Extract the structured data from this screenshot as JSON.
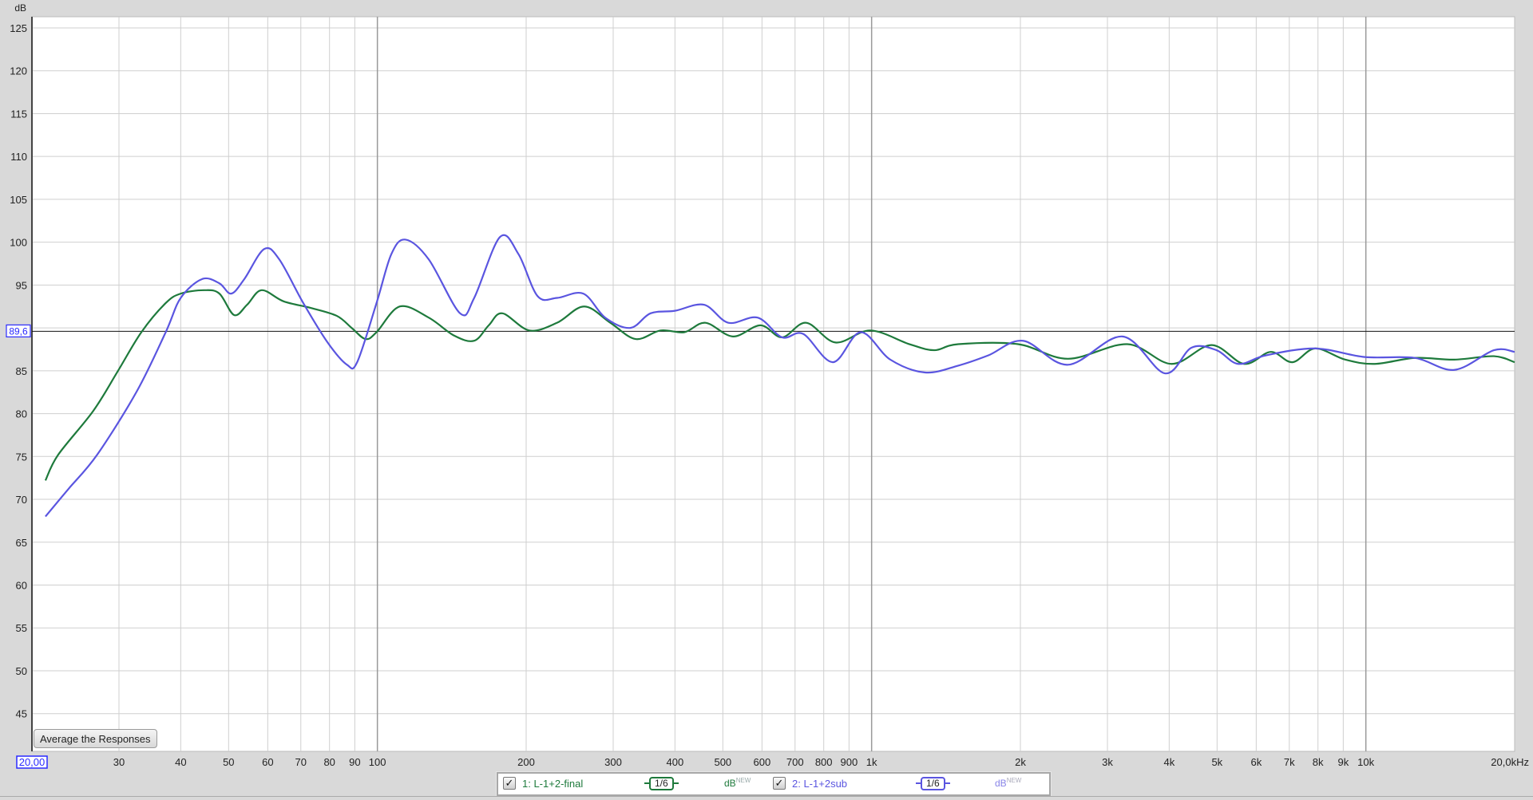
{
  "chart_data": {
    "type": "line",
    "ylabel": "dB",
    "xlabel": "Hz",
    "xscale": "log",
    "xlim": [
      20,
      20000
    ],
    "ylim": [
      40.6,
      126.3
    ],
    "grid": true,
    "y_ticks": [
      "125",
      "120",
      "115",
      "110",
      "105",
      "100",
      "95",
      "90",
      "85",
      "80",
      "75",
      "70",
      "65",
      "60",
      "55",
      "50",
      "45"
    ],
    "x_ticks": [
      {
        "f": 20,
        "label": "20,00"
      },
      {
        "f": 30,
        "label": "30"
      },
      {
        "f": 40,
        "label": "40"
      },
      {
        "f": 50,
        "label": "50"
      },
      {
        "f": 60,
        "label": "60"
      },
      {
        "f": 70,
        "label": "70"
      },
      {
        "f": 80,
        "label": "80"
      },
      {
        "f": 90,
        "label": "90"
      },
      {
        "f": 100,
        "label": "100"
      },
      {
        "f": 200,
        "label": "200"
      },
      {
        "f": 300,
        "label": "300"
      },
      {
        "f": 400,
        "label": "400"
      },
      {
        "f": 500,
        "label": "500"
      },
      {
        "f": 600,
        "label": "600"
      },
      {
        "f": 700,
        "label": "700"
      },
      {
        "f": 800,
        "label": "800"
      },
      {
        "f": 900,
        "label": "900"
      },
      {
        "f": 1000,
        "label": "1k"
      },
      {
        "f": 2000,
        "label": "2k"
      },
      {
        "f": 3000,
        "label": "3k"
      },
      {
        "f": 4000,
        "label": "4k"
      },
      {
        "f": 5000,
        "label": "5k"
      },
      {
        "f": 6000,
        "label": "6k"
      },
      {
        "f": 7000,
        "label": "7k"
      },
      {
        "f": 8000,
        "label": "8k"
      },
      {
        "f": 9000,
        "label": "9k"
      },
      {
        "f": 10000,
        "label": "10k"
      },
      {
        "f": 20000,
        "label": "20,0kHz"
      }
    ],
    "reference_line": {
      "value": 89.6,
      "label": "89,6"
    },
    "series": [
      {
        "name": "1: L-1+2-final",
        "color": "#1e7a3c",
        "smoothing": "1/6",
        "unit": "dB",
        "unit_sup": "NEW",
        "points": [
          [
            21.3,
            72.2
          ],
          [
            22.6,
            75.2
          ],
          [
            26.6,
            80.3
          ],
          [
            29.8,
            84.9
          ],
          [
            33.3,
            89.5
          ],
          [
            37.3,
            92.9
          ],
          [
            40,
            94
          ],
          [
            44.6,
            94.4
          ],
          [
            47.9,
            94
          ],
          [
            51.3,
            91.5
          ],
          [
            54.5,
            92.7
          ],
          [
            58.3,
            94.4
          ],
          [
            64.6,
            93.1
          ],
          [
            73.7,
            92.3
          ],
          [
            82.8,
            91.4
          ],
          [
            88.7,
            90
          ],
          [
            94.6,
            88.7
          ],
          [
            99.6,
            89.5
          ],
          [
            111,
            92.5
          ],
          [
            127,
            91.2
          ],
          [
            143,
            89.1
          ],
          [
            157,
            88.5
          ],
          [
            168,
            90.3
          ],
          [
            179,
            91.7
          ],
          [
            203,
            89.7
          ],
          [
            231,
            90.6
          ],
          [
            262,
            92.5
          ],
          [
            296,
            90.6
          ],
          [
            333,
            88.7
          ],
          [
            374,
            89.7
          ],
          [
            418,
            89.5
          ],
          [
            461,
            90.6
          ],
          [
            524,
            89
          ],
          [
            596,
            90.3
          ],
          [
            659,
            88.9
          ],
          [
            737,
            90.6
          ],
          [
            845,
            88.3
          ],
          [
            994,
            89.7
          ],
          [
            1193,
            88.1
          ],
          [
            1339,
            87.4
          ],
          [
            1497,
            88.1
          ],
          [
            1979,
            88.1
          ],
          [
            2495,
            86.4
          ],
          [
            3292,
            88.1
          ],
          [
            4045,
            85.8
          ],
          [
            4870,
            88
          ],
          [
            5672,
            85.8
          ],
          [
            6420,
            87.2
          ],
          [
            7103,
            86
          ],
          [
            7900,
            87.6
          ],
          [
            9080,
            86.3
          ],
          [
            10430,
            85.8
          ],
          [
            12550,
            86.5
          ],
          [
            15100,
            86.3
          ],
          [
            18160,
            86.7
          ],
          [
            20000,
            86
          ]
        ]
      },
      {
        "name": "2: L-1+2sub",
        "color": "#5a55e0",
        "smoothing": "1/6",
        "unit": "dB",
        "unit_sup": "NEW",
        "points": [
          [
            21.3,
            68
          ],
          [
            23.7,
            71.2
          ],
          [
            27.1,
            75.2
          ],
          [
            32.6,
            82.6
          ],
          [
            37.3,
            89.5
          ],
          [
            40,
            93.5
          ],
          [
            44.2,
            95.7
          ],
          [
            47.9,
            95.2
          ],
          [
            50.6,
            94
          ],
          [
            53.8,
            95.7
          ],
          [
            59,
            99.2
          ],
          [
            63.3,
            98
          ],
          [
            70.8,
            92.9
          ],
          [
            79.3,
            88.3
          ],
          [
            86.8,
            85.7
          ],
          [
            91,
            86
          ],
          [
            99.6,
            92.9
          ],
          [
            106.7,
            98.6
          ],
          [
            114,
            100.3
          ],
          [
            127,
            98
          ],
          [
            147,
            91.7
          ],
          [
            157,
            93.5
          ],
          [
            177,
            100.6
          ],
          [
            193,
            98.6
          ],
          [
            211,
            93.7
          ],
          [
            231,
            93.5
          ],
          [
            261,
            94
          ],
          [
            289,
            91.2
          ],
          [
            325,
            90
          ],
          [
            357,
            91.7
          ],
          [
            400,
            92
          ],
          [
            458,
            92.7
          ],
          [
            513,
            90.6
          ],
          [
            588,
            91.2
          ],
          [
            659,
            88.9
          ],
          [
            727,
            89.3
          ],
          [
            835,
            86
          ],
          [
            950,
            89.5
          ],
          [
            1091,
            86.3
          ],
          [
            1283,
            84.8
          ],
          [
            1497,
            85.6
          ],
          [
            1723,
            86.8
          ],
          [
            2025,
            88.5
          ],
          [
            2495,
            85.7
          ],
          [
            3217,
            89
          ],
          [
            3920,
            84.7
          ],
          [
            4440,
            87.7
          ],
          [
            4988,
            87.4
          ],
          [
            5520,
            85.8
          ],
          [
            6280,
            86.8
          ],
          [
            7900,
            87.6
          ],
          [
            9950,
            86.6
          ],
          [
            12550,
            86.5
          ],
          [
            15100,
            85.1
          ],
          [
            18160,
            87.4
          ],
          [
            20000,
            87.2
          ]
        ]
      }
    ]
  },
  "controls": {
    "average_button": "Average the Responses"
  },
  "legend": [
    {
      "checked": "✓",
      "label": "1: L-1+2-final",
      "smoothing": "1/6",
      "unit": "dB",
      "sup": "NEW"
    },
    {
      "checked": "✓",
      "label": "2: L-1+2sub",
      "smoothing": "1/6",
      "unit": "dB",
      "sup": "NEW"
    }
  ]
}
